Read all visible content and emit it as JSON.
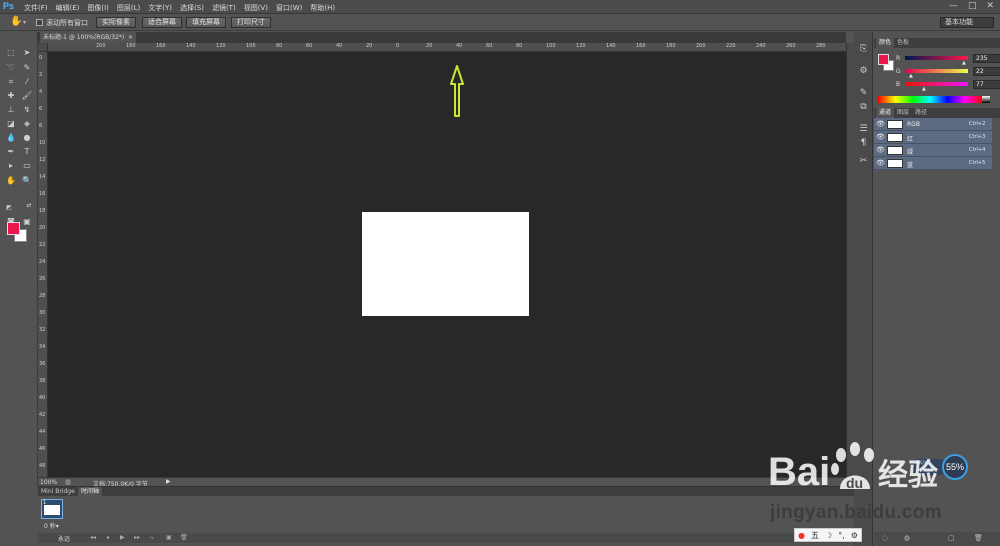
{
  "app": {
    "logo": "Ps"
  },
  "menus": [
    "文件(F)",
    "编辑(E)",
    "图像(I)",
    "图层(L)",
    "文字(Y)",
    "选择(S)",
    "滤镜(T)",
    "视图(V)",
    "窗口(W)",
    "帮助(H)"
  ],
  "window_controls": [
    "—",
    "□",
    "✕"
  ],
  "options_bar": {
    "scroll_all_windows": "滚动所有窗口",
    "buttons": [
      "实际像素",
      "适合屏幕",
      "填充屏幕",
      "打印尺寸"
    ],
    "workspace": "基本功能"
  },
  "document_tab": {
    "title": "未标题-1 @ 100%(RGB/32*)",
    "close": "×"
  },
  "ruler": {
    "top_labels": [
      "200",
      "180",
      "160",
      "140",
      "120",
      "100",
      "80",
      "60",
      "40",
      "20",
      "0",
      "20",
      "40",
      "60",
      "80",
      "100",
      "120",
      "140",
      "160",
      "180",
      "200",
      "220",
      "240",
      "260",
      "280",
      "300",
      "320"
    ],
    "left_labels": [
      "0",
      "2",
      "4",
      "6",
      "8",
      "10",
      "12",
      "14",
      "16",
      "18",
      "20",
      "22",
      "24",
      "26",
      "28",
      "30",
      "32",
      "34",
      "36",
      "38",
      "40",
      "42",
      "44",
      "46",
      "48"
    ]
  },
  "status": {
    "zoom": "100%",
    "doc": "文档:750.0K/0 字节",
    "play": "▶"
  },
  "bottom_panel": {
    "tabs": [
      "Mini Bridge",
      "时间轴"
    ],
    "frame_number": "1",
    "frame_time": "0 秒▾",
    "loop": "永远",
    "controls": [
      "◂◂",
      "◂",
      "▶",
      "▸▸",
      "⤷",
      "▣",
      "🗑"
    ]
  },
  "color_panel": {
    "tabs": [
      "颜色",
      "色板"
    ],
    "fg_color": "#eb164d",
    "bg_color": "#ffffff",
    "channels": [
      {
        "label": "R",
        "value": "235"
      },
      {
        "label": "G",
        "value": "22"
      },
      {
        "label": "B",
        "value": "77"
      }
    ]
  },
  "channels_panel": {
    "tabs": [
      "通道",
      "图层",
      "路径"
    ],
    "rows": [
      {
        "name": "RGB",
        "shortcut": "Ctrl+2"
      },
      {
        "name": "红",
        "shortcut": "Ctrl+3"
      },
      {
        "name": "绿",
        "shortcut": "Ctrl+4"
      },
      {
        "name": "蓝",
        "shortcut": "Ctrl+5"
      }
    ]
  },
  "widgets": {
    "speed_percent": "55%",
    "speed_text": "0K/s",
    "ime": [
      "五",
      "☽",
      "°,",
      "⚙"
    ]
  },
  "watermark": {
    "url": "jingyan.baidu.com"
  }
}
